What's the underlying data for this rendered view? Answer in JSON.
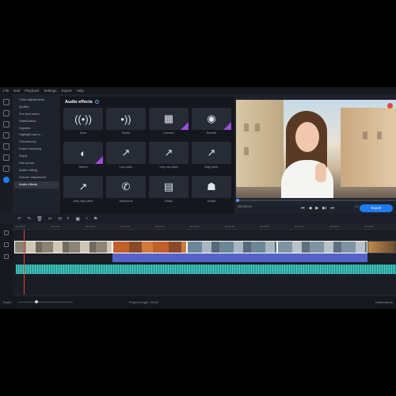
{
  "menu": [
    "File",
    "Edit",
    "Playback",
    "Settings",
    "Export",
    "Help"
  ],
  "categories": [
    "Color adjustments",
    "Quality",
    "Fun and warm",
    "Stabilization",
    "Vignette",
    "Highlight and s...",
    "Chroma key",
    "Frame blending",
    "Sepia",
    "Old-school",
    "Audio editing",
    "Volume adjustment",
    "Audio effects"
  ],
  "active_category_index": 12,
  "effects_panel": {
    "title": "Audio effects",
    "effects": [
      {
        "label": "Echo",
        "icon": "echo-icon",
        "glyph": "((•))",
        "premium": false
      },
      {
        "label": "Radio",
        "icon": "radio-wave-icon",
        "glyph": "•))",
        "premium": false
      },
      {
        "label": "Concert",
        "icon": "speaker-grid-icon",
        "glyph": "▦",
        "premium": true
      },
      {
        "label": "Reverb",
        "icon": "swirl-icon",
        "glyph": "◉",
        "premium": true
      },
      {
        "label": "Stereo",
        "icon": "stereo-icon",
        "glyph": "◐",
        "premium": true
      },
      {
        "label": "Low pitch",
        "icon": "low-pitch-icon",
        "glyph": "↗",
        "premium": false
      },
      {
        "label": "Very low pitch",
        "icon": "very-low-pitch-icon",
        "glyph": "↗",
        "premium": false
      },
      {
        "label": "High pitch",
        "icon": "high-pitch-icon",
        "glyph": "↗",
        "premium": false
      },
      {
        "label": "Very high pitch",
        "icon": "very-high-pitch-icon",
        "glyph": "↗",
        "premium": false
      },
      {
        "label": "Telephone",
        "icon": "telephone-icon",
        "glyph": "✆",
        "premium": false
      },
      {
        "label": "Radio",
        "icon": "radio-icon",
        "glyph": "▤",
        "premium": false
      },
      {
        "label": "Robot",
        "icon": "robot-icon",
        "glyph": "☗",
        "premium": false
      }
    ]
  },
  "player": {
    "time": "000:00:00",
    "zoom": "1:1",
    "export_label": "Export",
    "progress": 0.0,
    "controls": [
      "⏮",
      "◀",
      "▶",
      "▶|",
      "⏭"
    ]
  },
  "timeline_tools": [
    "↶",
    "↷",
    "🗑",
    "✂",
    "⟲",
    "◐",
    "▣",
    "♪",
    "⚑"
  ],
  "ruler_labels": [
    "00:00:00",
    "00:00:05",
    "00:00:10",
    "00:00:15",
    "00:00:20",
    "00:00:25",
    "00:00:30",
    "00:00:35",
    "00:00:40",
    "00:00:45",
    "00:00:50"
  ],
  "status": {
    "scale_label": "Scale:",
    "scale_level": 0.32,
    "project_length": "Project length: 00:48",
    "notifications": "Notifications"
  },
  "colors": {
    "accent": "#1e7bf0",
    "premium_tag": "#a04ce0",
    "audio_track": "#1aa39a",
    "effect_bar": "#5563c9",
    "playhead": "#e0463a"
  }
}
